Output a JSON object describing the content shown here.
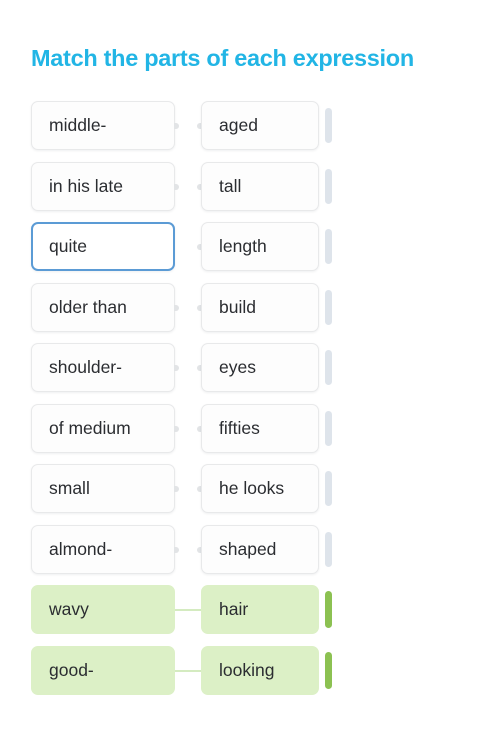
{
  "title": "Match the parts of each expression",
  "colors": {
    "title": "#22b5e5",
    "card_text": "#2b2d31",
    "card_bg": "#fdfdfd",
    "card_border": "#e8e9ea",
    "selected_border": "#5b9bd5",
    "matched_bg": "#dcf0c6",
    "matched_handle": "#8cc152",
    "handle": "#dee4eb",
    "page_bg": "#ffffff"
  },
  "icons": {
    "drag_handle": "drag-handle-icon",
    "connector_nub": "connector-nub-icon",
    "connector_line": "connector-line-icon"
  },
  "rows": [
    {
      "left": "middle-",
      "right": "aged",
      "state": "default"
    },
    {
      "left": "in his late",
      "right": "tall",
      "state": "default"
    },
    {
      "left": "quite",
      "right": "length",
      "state": "selected"
    },
    {
      "left": "older than",
      "right": "build",
      "state": "default"
    },
    {
      "left": "shoulder-",
      "right": "eyes",
      "state": "default"
    },
    {
      "left": "of medium",
      "right": "fifties",
      "state": "default"
    },
    {
      "left": "small",
      "right": "he looks",
      "state": "default"
    },
    {
      "left": "almond-",
      "right": "shaped",
      "state": "default"
    },
    {
      "left": "wavy",
      "right": "hair",
      "state": "matched"
    },
    {
      "left": "good-",
      "right": "looking",
      "state": "matched"
    }
  ]
}
